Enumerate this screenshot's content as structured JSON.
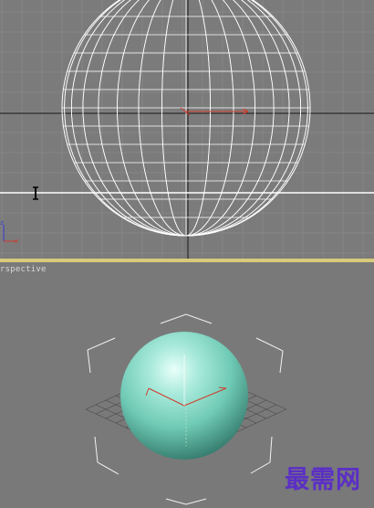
{
  "viewports": {
    "front": {
      "label": ""
    },
    "perspective": {
      "label": "rspective"
    }
  },
  "axis_tripod": {
    "x_label": "x",
    "y_label": "y",
    "z_label": "z"
  },
  "watermark": {
    "text": "最需网"
  },
  "colors": {
    "grid_minor": "#8a8a8a",
    "grid_major": "#2a2a2a",
    "wireframe": "#ffffff",
    "sphere": "#7fd8c4",
    "gizmo": "#d23a2a",
    "viewport_active_border": "#d9c97a"
  }
}
